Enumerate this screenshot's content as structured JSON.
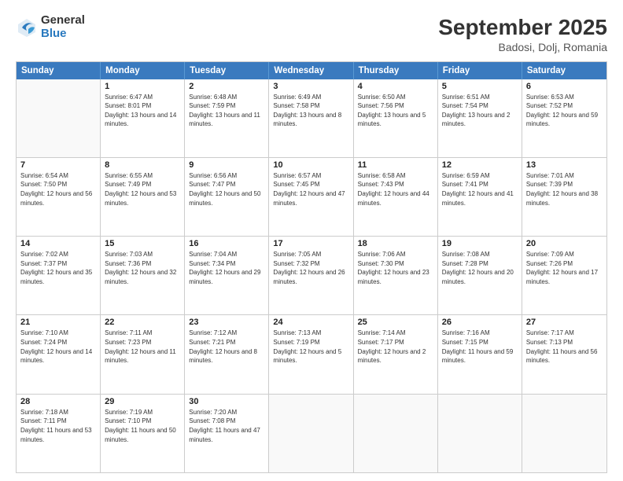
{
  "logo": {
    "general": "General",
    "blue": "Blue"
  },
  "title": "September 2025",
  "location": "Badosi, Dolj, Romania",
  "header_days": [
    "Sunday",
    "Monday",
    "Tuesday",
    "Wednesday",
    "Thursday",
    "Friday",
    "Saturday"
  ],
  "weeks": [
    [
      {
        "day": "",
        "sunrise": "",
        "sunset": "",
        "daylight": ""
      },
      {
        "day": "1",
        "sunrise": "Sunrise: 6:47 AM",
        "sunset": "Sunset: 8:01 PM",
        "daylight": "Daylight: 13 hours and 14 minutes."
      },
      {
        "day": "2",
        "sunrise": "Sunrise: 6:48 AM",
        "sunset": "Sunset: 7:59 PM",
        "daylight": "Daylight: 13 hours and 11 minutes."
      },
      {
        "day": "3",
        "sunrise": "Sunrise: 6:49 AM",
        "sunset": "Sunset: 7:58 PM",
        "daylight": "Daylight: 13 hours and 8 minutes."
      },
      {
        "day": "4",
        "sunrise": "Sunrise: 6:50 AM",
        "sunset": "Sunset: 7:56 PM",
        "daylight": "Daylight: 13 hours and 5 minutes."
      },
      {
        "day": "5",
        "sunrise": "Sunrise: 6:51 AM",
        "sunset": "Sunset: 7:54 PM",
        "daylight": "Daylight: 13 hours and 2 minutes."
      },
      {
        "day": "6",
        "sunrise": "Sunrise: 6:53 AM",
        "sunset": "Sunset: 7:52 PM",
        "daylight": "Daylight: 12 hours and 59 minutes."
      }
    ],
    [
      {
        "day": "7",
        "sunrise": "Sunrise: 6:54 AM",
        "sunset": "Sunset: 7:50 PM",
        "daylight": "Daylight: 12 hours and 56 minutes."
      },
      {
        "day": "8",
        "sunrise": "Sunrise: 6:55 AM",
        "sunset": "Sunset: 7:49 PM",
        "daylight": "Daylight: 12 hours and 53 minutes."
      },
      {
        "day": "9",
        "sunrise": "Sunrise: 6:56 AM",
        "sunset": "Sunset: 7:47 PM",
        "daylight": "Daylight: 12 hours and 50 minutes."
      },
      {
        "day": "10",
        "sunrise": "Sunrise: 6:57 AM",
        "sunset": "Sunset: 7:45 PM",
        "daylight": "Daylight: 12 hours and 47 minutes."
      },
      {
        "day": "11",
        "sunrise": "Sunrise: 6:58 AM",
        "sunset": "Sunset: 7:43 PM",
        "daylight": "Daylight: 12 hours and 44 minutes."
      },
      {
        "day": "12",
        "sunrise": "Sunrise: 6:59 AM",
        "sunset": "Sunset: 7:41 PM",
        "daylight": "Daylight: 12 hours and 41 minutes."
      },
      {
        "day": "13",
        "sunrise": "Sunrise: 7:01 AM",
        "sunset": "Sunset: 7:39 PM",
        "daylight": "Daylight: 12 hours and 38 minutes."
      }
    ],
    [
      {
        "day": "14",
        "sunrise": "Sunrise: 7:02 AM",
        "sunset": "Sunset: 7:37 PM",
        "daylight": "Daylight: 12 hours and 35 minutes."
      },
      {
        "day": "15",
        "sunrise": "Sunrise: 7:03 AM",
        "sunset": "Sunset: 7:36 PM",
        "daylight": "Daylight: 12 hours and 32 minutes."
      },
      {
        "day": "16",
        "sunrise": "Sunrise: 7:04 AM",
        "sunset": "Sunset: 7:34 PM",
        "daylight": "Daylight: 12 hours and 29 minutes."
      },
      {
        "day": "17",
        "sunrise": "Sunrise: 7:05 AM",
        "sunset": "Sunset: 7:32 PM",
        "daylight": "Daylight: 12 hours and 26 minutes."
      },
      {
        "day": "18",
        "sunrise": "Sunrise: 7:06 AM",
        "sunset": "Sunset: 7:30 PM",
        "daylight": "Daylight: 12 hours and 23 minutes."
      },
      {
        "day": "19",
        "sunrise": "Sunrise: 7:08 AM",
        "sunset": "Sunset: 7:28 PM",
        "daylight": "Daylight: 12 hours and 20 minutes."
      },
      {
        "day": "20",
        "sunrise": "Sunrise: 7:09 AM",
        "sunset": "Sunset: 7:26 PM",
        "daylight": "Daylight: 12 hours and 17 minutes."
      }
    ],
    [
      {
        "day": "21",
        "sunrise": "Sunrise: 7:10 AM",
        "sunset": "Sunset: 7:24 PM",
        "daylight": "Daylight: 12 hours and 14 minutes."
      },
      {
        "day": "22",
        "sunrise": "Sunrise: 7:11 AM",
        "sunset": "Sunset: 7:23 PM",
        "daylight": "Daylight: 12 hours and 11 minutes."
      },
      {
        "day": "23",
        "sunrise": "Sunrise: 7:12 AM",
        "sunset": "Sunset: 7:21 PM",
        "daylight": "Daylight: 12 hours and 8 minutes."
      },
      {
        "day": "24",
        "sunrise": "Sunrise: 7:13 AM",
        "sunset": "Sunset: 7:19 PM",
        "daylight": "Daylight: 12 hours and 5 minutes."
      },
      {
        "day": "25",
        "sunrise": "Sunrise: 7:14 AM",
        "sunset": "Sunset: 7:17 PM",
        "daylight": "Daylight: 12 hours and 2 minutes."
      },
      {
        "day": "26",
        "sunrise": "Sunrise: 7:16 AM",
        "sunset": "Sunset: 7:15 PM",
        "daylight": "Daylight: 11 hours and 59 minutes."
      },
      {
        "day": "27",
        "sunrise": "Sunrise: 7:17 AM",
        "sunset": "Sunset: 7:13 PM",
        "daylight": "Daylight: 11 hours and 56 minutes."
      }
    ],
    [
      {
        "day": "28",
        "sunrise": "Sunrise: 7:18 AM",
        "sunset": "Sunset: 7:11 PM",
        "daylight": "Daylight: 11 hours and 53 minutes."
      },
      {
        "day": "29",
        "sunrise": "Sunrise: 7:19 AM",
        "sunset": "Sunset: 7:10 PM",
        "daylight": "Daylight: 11 hours and 50 minutes."
      },
      {
        "day": "30",
        "sunrise": "Sunrise: 7:20 AM",
        "sunset": "Sunset: 7:08 PM",
        "daylight": "Daylight: 11 hours and 47 minutes."
      },
      {
        "day": "",
        "sunrise": "",
        "sunset": "",
        "daylight": ""
      },
      {
        "day": "",
        "sunrise": "",
        "sunset": "",
        "daylight": ""
      },
      {
        "day": "",
        "sunrise": "",
        "sunset": "",
        "daylight": ""
      },
      {
        "day": "",
        "sunrise": "",
        "sunset": "",
        "daylight": ""
      }
    ]
  ]
}
